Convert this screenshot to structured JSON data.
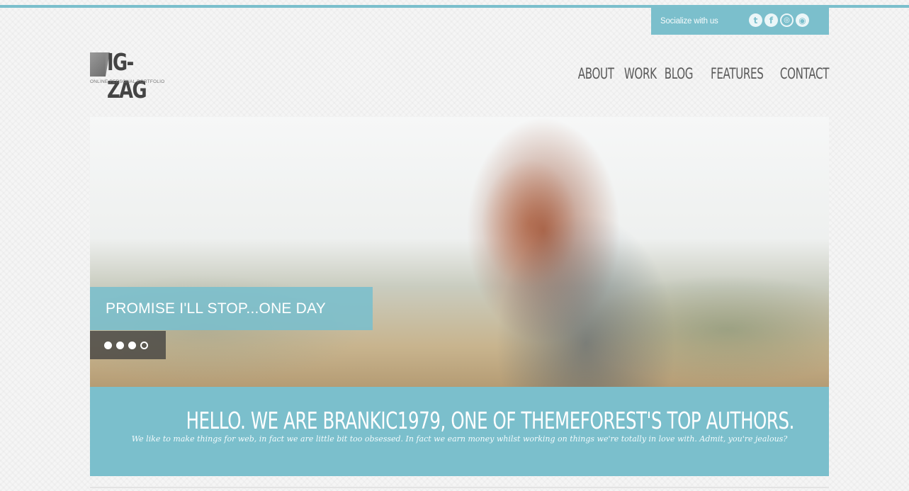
{
  "social": {
    "label": "Socialize with us",
    "icons": [
      "twitter-icon",
      "facebook-icon",
      "dribbble-icon",
      "rss-icon"
    ]
  },
  "logo": {
    "text": "IG-ZAG",
    "tagline": "ONLINE PERSONAL PORTFOLIO"
  },
  "nav": {
    "items": [
      {
        "label": "ABOUT"
      },
      {
        "label": "WORK"
      },
      {
        "label": "BLOG"
      },
      {
        "label": "FEATURES"
      },
      {
        "label": "CONTACT"
      }
    ]
  },
  "hero": {
    "caption": "PROMISE I'LL STOP...ONE DAY",
    "slides_total": 4,
    "active_slide": 4
  },
  "intro": {
    "title": "HELLO. WE ARE BRANKIC1979, ONE OF THEMEFOREST'S TOP AUTHORS.",
    "text": "We like to make things for web, in fact we are little bit too obsessed. In fact we earn money whilst working on things we're totally in love with. Admit, you're jealous?"
  },
  "colors": {
    "accent": "#7bbfcc",
    "nav_text": "#5a5a5a",
    "logo_text": "#444444"
  }
}
